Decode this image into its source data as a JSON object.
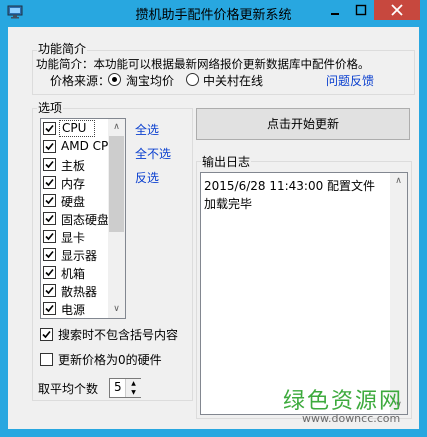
{
  "window": {
    "title": "攒机助手配件价格更新系统",
    "colors": {
      "frame": "#28a7e0",
      "close_button": "#c7483e",
      "link": "#0a3fcf"
    },
    "controls": {
      "minimize": "—",
      "maximize": "□",
      "close": "✕"
    }
  },
  "intro": {
    "legend": "功能简介",
    "text": "功能简介：本功能可以根据最新网络报价更新数据库中配件价格。",
    "source_label": "价格来源：",
    "sources": [
      {
        "label": "淘宝均价",
        "selected": true
      },
      {
        "label": "中关村在线",
        "selected": false
      }
    ],
    "feedback_link": "问题反馈"
  },
  "options": {
    "legend": "选项",
    "items": [
      {
        "label": "CPU",
        "checked": true
      },
      {
        "label": "AMD CPU",
        "checked": true
      },
      {
        "label": "主板",
        "checked": true
      },
      {
        "label": "内存",
        "checked": true
      },
      {
        "label": "硬盘",
        "checked": true
      },
      {
        "label": "固态硬盘",
        "checked": true
      },
      {
        "label": "显卡",
        "checked": true
      },
      {
        "label": "显示器",
        "checked": true
      },
      {
        "label": "机箱",
        "checked": true
      },
      {
        "label": "散热器",
        "checked": true
      },
      {
        "label": "电源",
        "checked": true
      }
    ],
    "select_all": "全选",
    "select_none": "全不选",
    "invert": "反选",
    "exclude_brackets": {
      "label": "搜索时不包含括号内容",
      "checked": true
    },
    "only_zero_price": {
      "label": "更新价格为0的硬件",
      "checked": false
    },
    "average_count": {
      "label": "取平均个数",
      "value": "5"
    }
  },
  "actions": {
    "start_update": "点击开始更新"
  },
  "log": {
    "legend": "输出日志",
    "text": "2015/6/28 11:43:00 配置文件加载完毕"
  },
  "watermark": {
    "text": "绿色资源网",
    "url": "www.downcc.com"
  }
}
